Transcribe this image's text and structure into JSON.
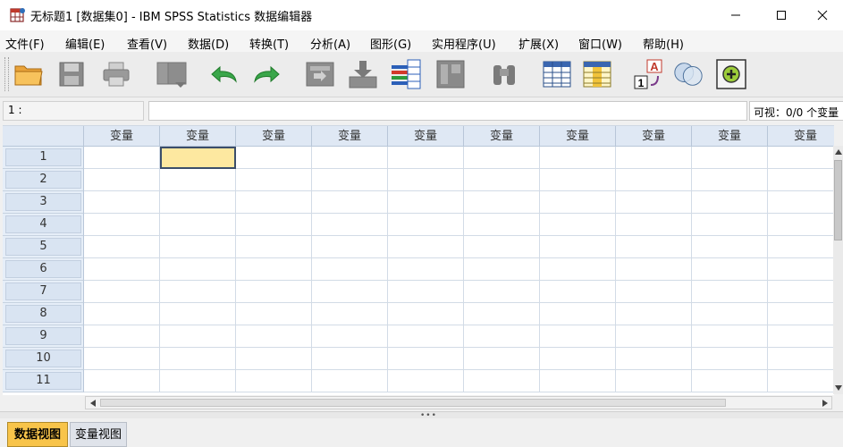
{
  "window": {
    "title": "无标题1 [数据集0] - IBM SPSS Statistics 数据编辑器",
    "controls": [
      "minimize",
      "maximize",
      "close"
    ]
  },
  "menubar": {
    "items": [
      {
        "label": "文件(F)"
      },
      {
        "label": "编辑(E)"
      },
      {
        "label": "查看(V)"
      },
      {
        "label": "数据(D)"
      },
      {
        "label": "转换(T)"
      },
      {
        "label": "分析(A)"
      },
      {
        "label": "图形(G)"
      },
      {
        "label": "实用程序(U)"
      },
      {
        "label": "扩展(X)"
      },
      {
        "label": "窗口(W)"
      },
      {
        "label": "帮助(H)"
      }
    ]
  },
  "toolbar": {
    "icons": [
      "open-folder-icon",
      "save-icon",
      "print-icon",
      "dialog-recall-icon",
      "undo-icon",
      "redo-icon",
      "goto-case-icon",
      "goto-variable-icon",
      "variables-icon",
      "run-descriptives-icon",
      "find-icon",
      "insert-cases-icon",
      "insert-variable-icon",
      "value-labels-icon",
      "use-variable-sets-icon",
      "extension-add-icon"
    ]
  },
  "cell_editor": {
    "reference": "1 :",
    "value": "",
    "visible_count": "可视：0/0 个变量"
  },
  "grid": {
    "column_headers": [
      "变量",
      "变量",
      "变量",
      "变量",
      "变量",
      "变量",
      "变量",
      "变量",
      "变量",
      "变量"
    ],
    "row_numbers": [
      "1",
      "2",
      "3",
      "4",
      "5",
      "6",
      "7",
      "8",
      "9",
      "10",
      "11"
    ],
    "active_cell": {
      "row": 1,
      "col": 2
    }
  },
  "tabs": {
    "data_view": "数据视图",
    "variable_view": "变量视图"
  },
  "colors": {
    "active_tab": "#f8c44a",
    "active_cell": "#fde8a0",
    "header_bg": "#dfe8f4"
  }
}
